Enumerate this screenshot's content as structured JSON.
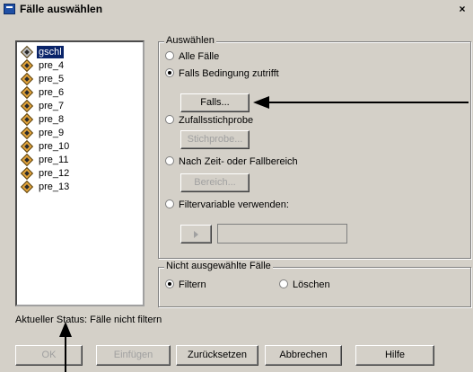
{
  "window": {
    "title": "Fälle auswählen",
    "close_glyph": "×"
  },
  "variables": [
    "gschl",
    "pre_4",
    "pre_5",
    "pre_6",
    "pre_7",
    "pre_8",
    "pre_9",
    "pre_10",
    "pre_11",
    "pre_12",
    "pre_13"
  ],
  "select_group": {
    "label": "Auswählen",
    "all_cases": "Alle Fälle",
    "if_condition": "Falls Bedingung zutrifft",
    "if_button": "Falls...",
    "random_sample": "Zufallsstichprobe",
    "sample_button": "Stichprobe...",
    "time_range": "Nach Zeit- oder Fallbereich",
    "range_button": "Bereich...",
    "filter_variable": "Filtervariable verwenden:",
    "selected": "if_condition"
  },
  "unselected_group": {
    "label": "Nicht ausgewählte Fälle",
    "filter": "Filtern",
    "delete": "Löschen",
    "selected": "filter"
  },
  "status_text": "Aktueller Status: Fälle nicht filtern",
  "buttons": {
    "ok": "OK",
    "paste": "Einfügen",
    "reset": "Zurücksetzen",
    "cancel": "Abbrechen",
    "help": "Hilfe"
  }
}
